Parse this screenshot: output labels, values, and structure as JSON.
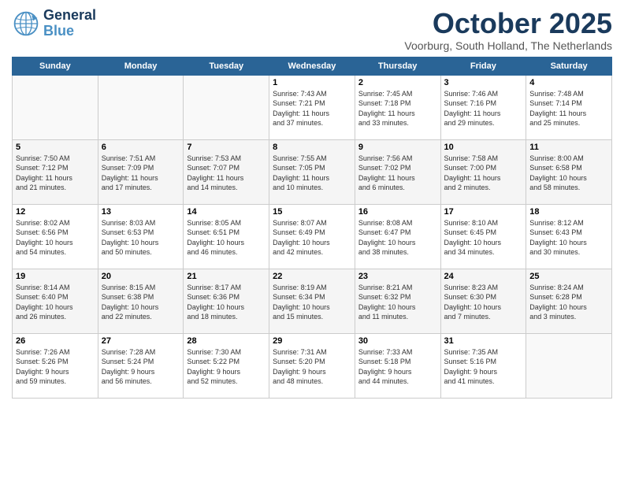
{
  "header": {
    "logo": {
      "general": "General",
      "blue": "Blue"
    },
    "title": "October 2025",
    "location": "Voorburg, South Holland, The Netherlands"
  },
  "weekdays": [
    "Sunday",
    "Monday",
    "Tuesday",
    "Wednesday",
    "Thursday",
    "Friday",
    "Saturday"
  ],
  "weeks": [
    [
      {
        "day": "",
        "info": ""
      },
      {
        "day": "",
        "info": ""
      },
      {
        "day": "",
        "info": ""
      },
      {
        "day": "1",
        "info": "Sunrise: 7:43 AM\nSunset: 7:21 PM\nDaylight: 11 hours\nand 37 minutes."
      },
      {
        "day": "2",
        "info": "Sunrise: 7:45 AM\nSunset: 7:18 PM\nDaylight: 11 hours\nand 33 minutes."
      },
      {
        "day": "3",
        "info": "Sunrise: 7:46 AM\nSunset: 7:16 PM\nDaylight: 11 hours\nand 29 minutes."
      },
      {
        "day": "4",
        "info": "Sunrise: 7:48 AM\nSunset: 7:14 PM\nDaylight: 11 hours\nand 25 minutes."
      }
    ],
    [
      {
        "day": "5",
        "info": "Sunrise: 7:50 AM\nSunset: 7:12 PM\nDaylight: 11 hours\nand 21 minutes."
      },
      {
        "day": "6",
        "info": "Sunrise: 7:51 AM\nSunset: 7:09 PM\nDaylight: 11 hours\nand 17 minutes."
      },
      {
        "day": "7",
        "info": "Sunrise: 7:53 AM\nSunset: 7:07 PM\nDaylight: 11 hours\nand 14 minutes."
      },
      {
        "day": "8",
        "info": "Sunrise: 7:55 AM\nSunset: 7:05 PM\nDaylight: 11 hours\nand 10 minutes."
      },
      {
        "day": "9",
        "info": "Sunrise: 7:56 AM\nSunset: 7:02 PM\nDaylight: 11 hours\nand 6 minutes."
      },
      {
        "day": "10",
        "info": "Sunrise: 7:58 AM\nSunset: 7:00 PM\nDaylight: 11 hours\nand 2 minutes."
      },
      {
        "day": "11",
        "info": "Sunrise: 8:00 AM\nSunset: 6:58 PM\nDaylight: 10 hours\nand 58 minutes."
      }
    ],
    [
      {
        "day": "12",
        "info": "Sunrise: 8:02 AM\nSunset: 6:56 PM\nDaylight: 10 hours\nand 54 minutes."
      },
      {
        "day": "13",
        "info": "Sunrise: 8:03 AM\nSunset: 6:53 PM\nDaylight: 10 hours\nand 50 minutes."
      },
      {
        "day": "14",
        "info": "Sunrise: 8:05 AM\nSunset: 6:51 PM\nDaylight: 10 hours\nand 46 minutes."
      },
      {
        "day": "15",
        "info": "Sunrise: 8:07 AM\nSunset: 6:49 PM\nDaylight: 10 hours\nand 42 minutes."
      },
      {
        "day": "16",
        "info": "Sunrise: 8:08 AM\nSunset: 6:47 PM\nDaylight: 10 hours\nand 38 minutes."
      },
      {
        "day": "17",
        "info": "Sunrise: 8:10 AM\nSunset: 6:45 PM\nDaylight: 10 hours\nand 34 minutes."
      },
      {
        "day": "18",
        "info": "Sunrise: 8:12 AM\nSunset: 6:43 PM\nDaylight: 10 hours\nand 30 minutes."
      }
    ],
    [
      {
        "day": "19",
        "info": "Sunrise: 8:14 AM\nSunset: 6:40 PM\nDaylight: 10 hours\nand 26 minutes."
      },
      {
        "day": "20",
        "info": "Sunrise: 8:15 AM\nSunset: 6:38 PM\nDaylight: 10 hours\nand 22 minutes."
      },
      {
        "day": "21",
        "info": "Sunrise: 8:17 AM\nSunset: 6:36 PM\nDaylight: 10 hours\nand 18 minutes."
      },
      {
        "day": "22",
        "info": "Sunrise: 8:19 AM\nSunset: 6:34 PM\nDaylight: 10 hours\nand 15 minutes."
      },
      {
        "day": "23",
        "info": "Sunrise: 8:21 AM\nSunset: 6:32 PM\nDaylight: 10 hours\nand 11 minutes."
      },
      {
        "day": "24",
        "info": "Sunrise: 8:23 AM\nSunset: 6:30 PM\nDaylight: 10 hours\nand 7 minutes."
      },
      {
        "day": "25",
        "info": "Sunrise: 8:24 AM\nSunset: 6:28 PM\nDaylight: 10 hours\nand 3 minutes."
      }
    ],
    [
      {
        "day": "26",
        "info": "Sunrise: 7:26 AM\nSunset: 5:26 PM\nDaylight: 9 hours\nand 59 minutes."
      },
      {
        "day": "27",
        "info": "Sunrise: 7:28 AM\nSunset: 5:24 PM\nDaylight: 9 hours\nand 56 minutes."
      },
      {
        "day": "28",
        "info": "Sunrise: 7:30 AM\nSunset: 5:22 PM\nDaylight: 9 hours\nand 52 minutes."
      },
      {
        "day": "29",
        "info": "Sunrise: 7:31 AM\nSunset: 5:20 PM\nDaylight: 9 hours\nand 48 minutes."
      },
      {
        "day": "30",
        "info": "Sunrise: 7:33 AM\nSunset: 5:18 PM\nDaylight: 9 hours\nand 44 minutes."
      },
      {
        "day": "31",
        "info": "Sunrise: 7:35 AM\nSunset: 5:16 PM\nDaylight: 9 hours\nand 41 minutes."
      },
      {
        "day": "",
        "info": ""
      }
    ]
  ]
}
